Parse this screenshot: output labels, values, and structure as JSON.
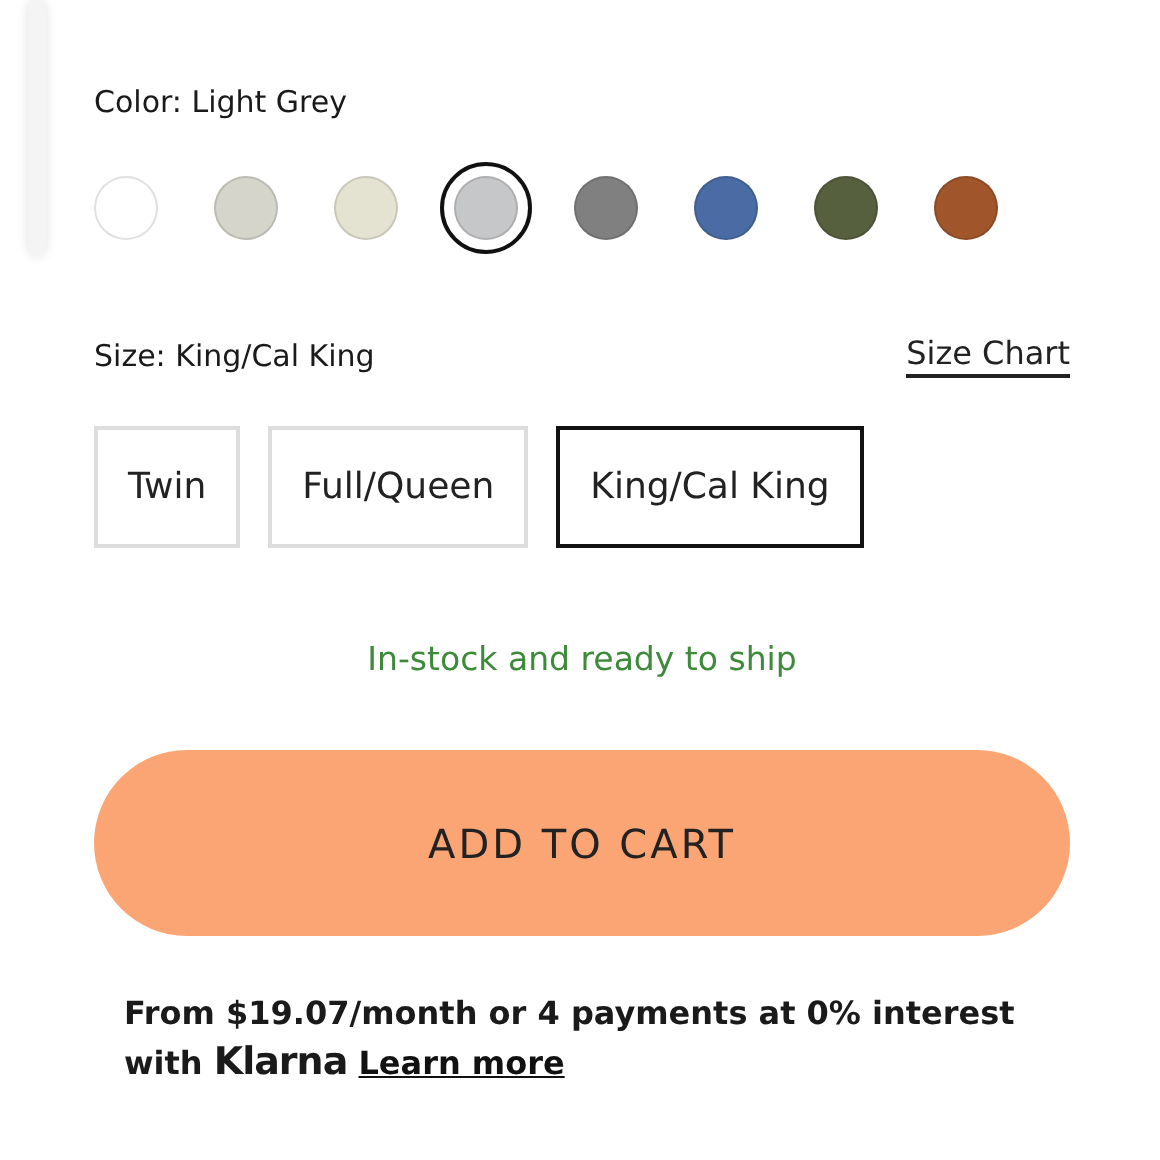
{
  "color_label": "Color: Light Grey",
  "swatches": [
    {
      "color": "#ffffff",
      "selected": false
    },
    {
      "color": "#d6d5cc",
      "selected": false
    },
    {
      "color": "#e4e3d2",
      "selected": false
    },
    {
      "color": "#c6c7c9",
      "selected": true
    },
    {
      "color": "#808080",
      "selected": false
    },
    {
      "color": "#4a6ba3",
      "selected": false
    },
    {
      "color": "#56603f",
      "selected": false
    },
    {
      "color": "#a0552b",
      "selected": false
    }
  ],
  "size_label": "Size: King/Cal King",
  "size_chart_link": "Size Chart",
  "sizes": [
    {
      "label": "Twin",
      "selected": false
    },
    {
      "label": "Full/Queen",
      "selected": false
    },
    {
      "label": "King/Cal King",
      "selected": true
    }
  ],
  "stock_status": "In-stock and ready to ship",
  "add_to_cart": "ADD TO CART",
  "financing": {
    "text": "From $19.07/month or 4 payments at 0% interest with **Klarna**",
    "link": "Learn more"
  }
}
